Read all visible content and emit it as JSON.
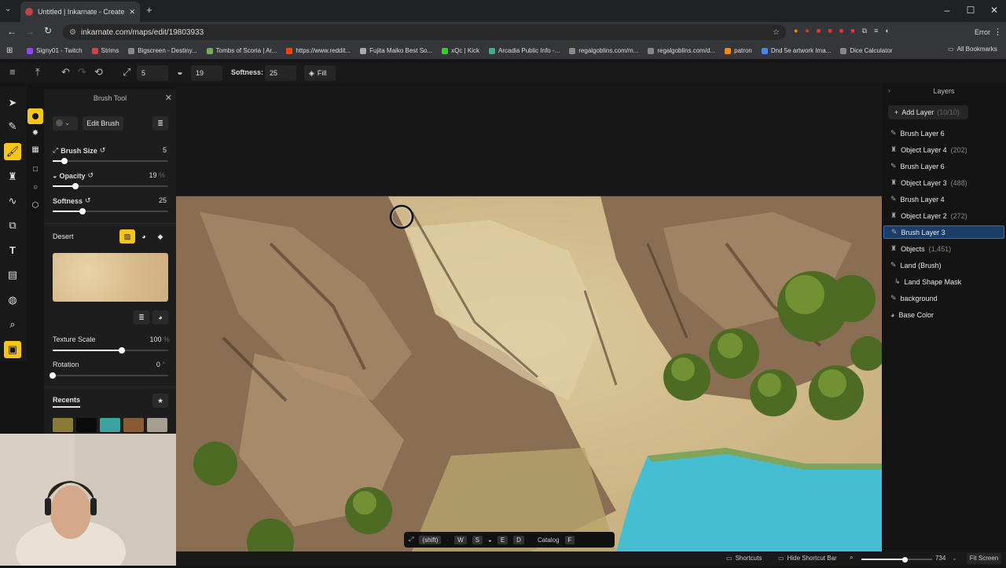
{
  "browser": {
    "tab_title": "Untitled | Inkarnate - Create Fa",
    "url": "inkarnate.com/maps/edit/19803933",
    "error_label": "Error"
  },
  "bookmarks": [
    "Signy01 - Twitch",
    "Strims",
    "Bigscreen - Destiny...",
    "Tombs of Scoria | Ar...",
    "https://www.reddit...",
    "Fujita Maiko Best So...",
    "xQc | Kick",
    "Arcadia Public Info -...",
    "regalgoblins.com/m...",
    "regalgoblins.com/d...",
    "patron",
    "Dnd 5e artwork Ima...",
    "Dice Calculator"
  ],
  "bookmarks_all": "All Bookmarks",
  "bookmark_colors": [
    "#9146ff",
    "#c44",
    "#888",
    "#7a5",
    "#f40",
    "#aaa",
    "#3c3",
    "#4a8",
    "#888",
    "#888",
    "#f80",
    "#48f",
    "#888"
  ],
  "toolbar": {
    "size_value": "5",
    "opacity_value": "19",
    "softness_label": "Softness:",
    "softness_value": "25",
    "fill_label": "Fill"
  },
  "brush_panel": {
    "title": "Brush Tool",
    "edit_brush": "Edit Brush",
    "brush_size_label": "Brush Size",
    "brush_size_value": "5",
    "brush_size_frac": 0.1,
    "opacity_label": "Opacity",
    "opacity_value": "19",
    "opacity_unit": "%",
    "opacity_frac": 0.2,
    "softness_label": "Softness",
    "softness_value": "25",
    "softness_frac": 0.26,
    "texture_name": "Desert",
    "texture_scale_label": "Texture Scale",
    "texture_scale_value": "100",
    "texture_scale_unit": "%",
    "texture_scale_frac": 0.6,
    "rotation_label": "Rotation",
    "rotation_value": "0",
    "rotation_unit": "°",
    "rotation_frac": 0.0,
    "recents_label": "Recents",
    "recent_colors": [
      "#8a7a3a",
      "#0b0b0b",
      "#3aa3a0",
      "#8a5a34",
      "#a79e8f"
    ]
  },
  "layers_panel": {
    "title": "Layers",
    "add_label": "Add Layer",
    "add_count": "(10/10)",
    "items": [
      {
        "name": "Brush Layer 6",
        "count": "",
        "icon": "brush-icon",
        "selected": false
      },
      {
        "name": "Object Layer 4",
        "count": "(202)",
        "icon": "object-icon",
        "selected": false
      },
      {
        "name": "Brush Layer 6",
        "count": "",
        "icon": "brush-icon",
        "selected": false
      },
      {
        "name": "Object Layer 3",
        "count": "(488)",
        "icon": "object-icon",
        "selected": false
      },
      {
        "name": "Brush Layer 4",
        "count": "",
        "icon": "brush-icon",
        "selected": false
      },
      {
        "name": "Object Layer 2",
        "count": "(272)",
        "icon": "object-icon",
        "selected": false
      },
      {
        "name": "Brush Layer 3",
        "count": "",
        "icon": "brush-icon",
        "selected": true
      },
      {
        "name": "Objects",
        "count": "(1,451)",
        "icon": "object-icon",
        "selected": false
      },
      {
        "name": "Land (Brush)",
        "count": "",
        "icon": "brush-icon",
        "selected": false
      },
      {
        "name": "Land Shape Mask",
        "count": "",
        "icon": "mask-icon",
        "selected": false
      },
      {
        "name": "background",
        "count": "",
        "icon": "brush-icon",
        "selected": false
      },
      {
        "name": "Base Color",
        "count": "",
        "icon": "palette-icon",
        "selected": false
      }
    ]
  },
  "shortcut_bar": {
    "shift": "(shift)",
    "w": "W",
    "s": "S",
    "e": "E",
    "d": "D",
    "catalog": "Catalog",
    "f": "F"
  },
  "status_bar": {
    "shortcuts": "Shortcuts",
    "hide": "Hide Shortcut Bar",
    "zoom": "734",
    "zoom_frac": 0.62,
    "fit": "Fit Screen"
  },
  "colors": {
    "accent": "#f5c518",
    "selected_layer": "#1c3d66",
    "water": "#46bdd1",
    "sand": "#d6c193",
    "rock": "#8a6e54"
  }
}
